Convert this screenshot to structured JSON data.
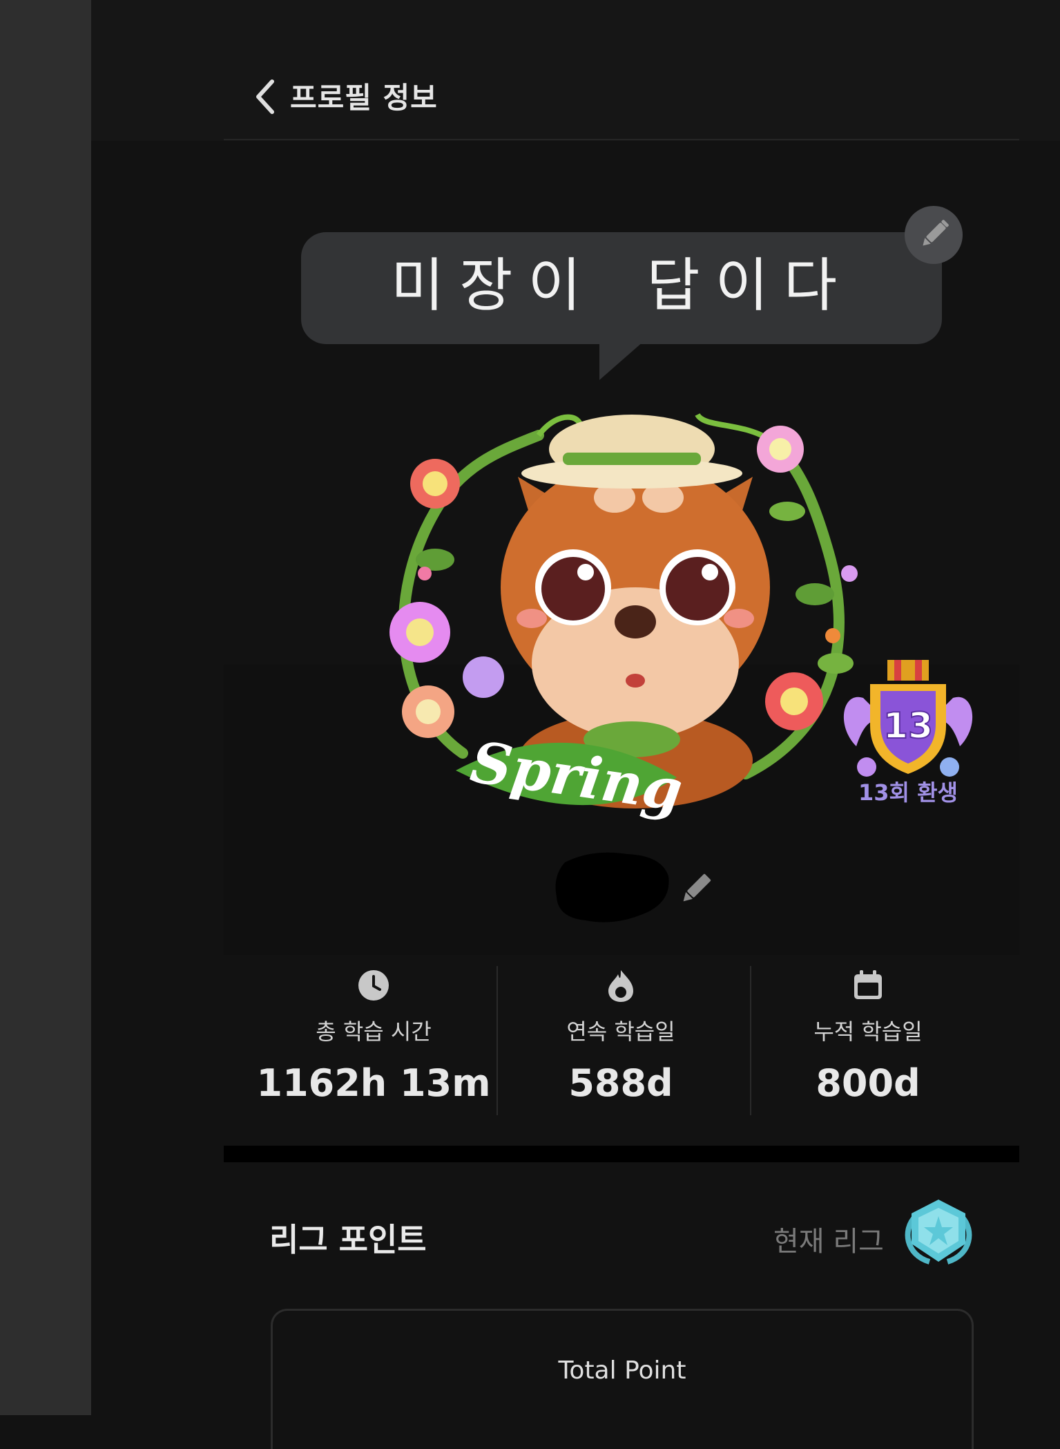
{
  "header": {
    "title": "프로필 정보",
    "back_icon": "chevron-left-icon"
  },
  "speech_bubble": {
    "text": "미장이 답이다",
    "edit_icon": "pencil-icon"
  },
  "avatar": {
    "ribbon_text": "Spring",
    "character": "shiba-dog-safari-hat",
    "wreath": "flower-vine-wreath"
  },
  "rebirth_badge": {
    "number": "13",
    "label": "13회 환생"
  },
  "profile": {
    "name_redacted": true,
    "edit_icon": "pencil-icon"
  },
  "stats": [
    {
      "icon": "clock-icon",
      "label": "총 학습 시간",
      "value": "1162h 13m"
    },
    {
      "icon": "fire-icon",
      "label": "연속 학습일",
      "value": "588d"
    },
    {
      "icon": "calendar-icon",
      "label": "누적 학습일",
      "value": "800d"
    }
  ],
  "league": {
    "title": "리그 포인트",
    "current_label": "현재 리그",
    "emblem_icon": "league-emblem-icon",
    "total_label": "Total Point"
  },
  "colors": {
    "background": "#121212",
    "bubble": "#333436",
    "rebirth_purple": "#a191e6",
    "league_teal": "#5cc8d8",
    "spring_green": "#3fa534"
  }
}
